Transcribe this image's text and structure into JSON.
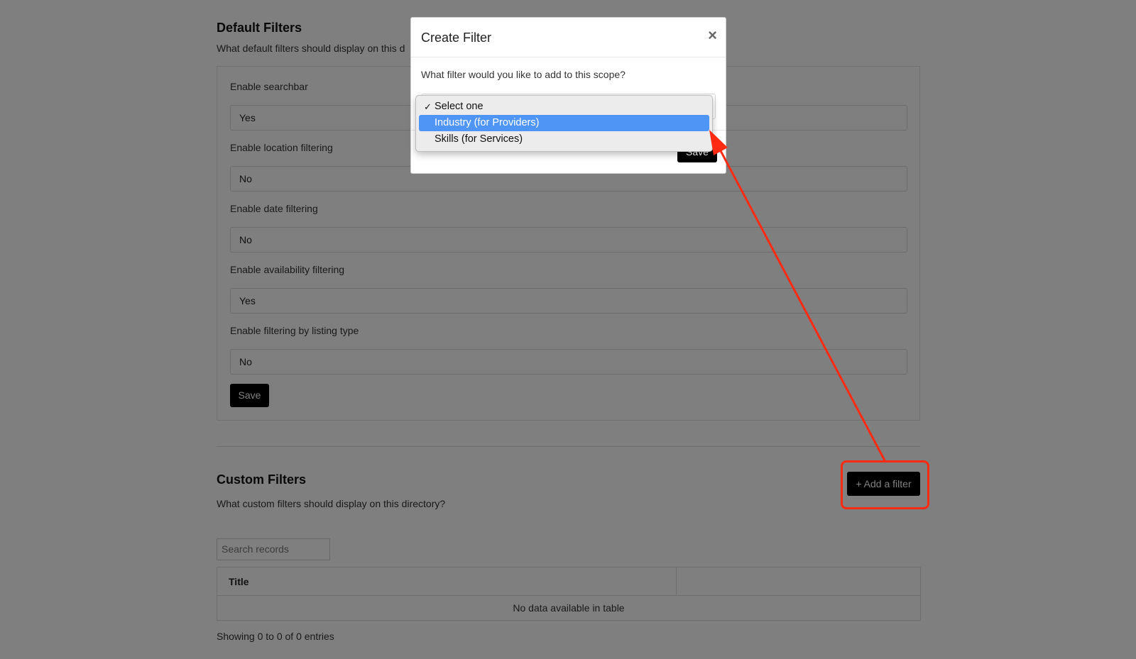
{
  "default_filters": {
    "title": "Default Filters",
    "description": "What default filters should display on this d",
    "fields": [
      {
        "label": "Enable searchbar",
        "value": "Yes"
      },
      {
        "label": "Enable location filtering",
        "value": "No"
      },
      {
        "label": "Enable date filtering",
        "value": "No"
      },
      {
        "label": "Enable availability filtering",
        "value": "Yes"
      },
      {
        "label": "Enable filtering by listing type",
        "value": "No"
      }
    ],
    "save_label": "Save"
  },
  "custom_filters": {
    "title": "Custom Filters",
    "description": "What custom filters should display on this directory?",
    "add_button_label": "+ Add a filter",
    "search_placeholder": "Search records",
    "table": {
      "columns": [
        "Title",
        ""
      ],
      "empty_message": "No data available in table"
    },
    "entries_info": "Showing 0 to 0 of 0 entries"
  },
  "modal": {
    "title": "Create Filter",
    "close_icon": "close-icon",
    "question": "What filter would you like to add to this scope?",
    "save_label": "Save",
    "dropdown": {
      "options": [
        {
          "label": "Select one",
          "checked": true
        },
        {
          "label": "Industry (for Providers)",
          "highlighted": true
        },
        {
          "label": "Skills (for Services)"
        }
      ]
    }
  },
  "annotation": {
    "color": "#ff2a12"
  }
}
